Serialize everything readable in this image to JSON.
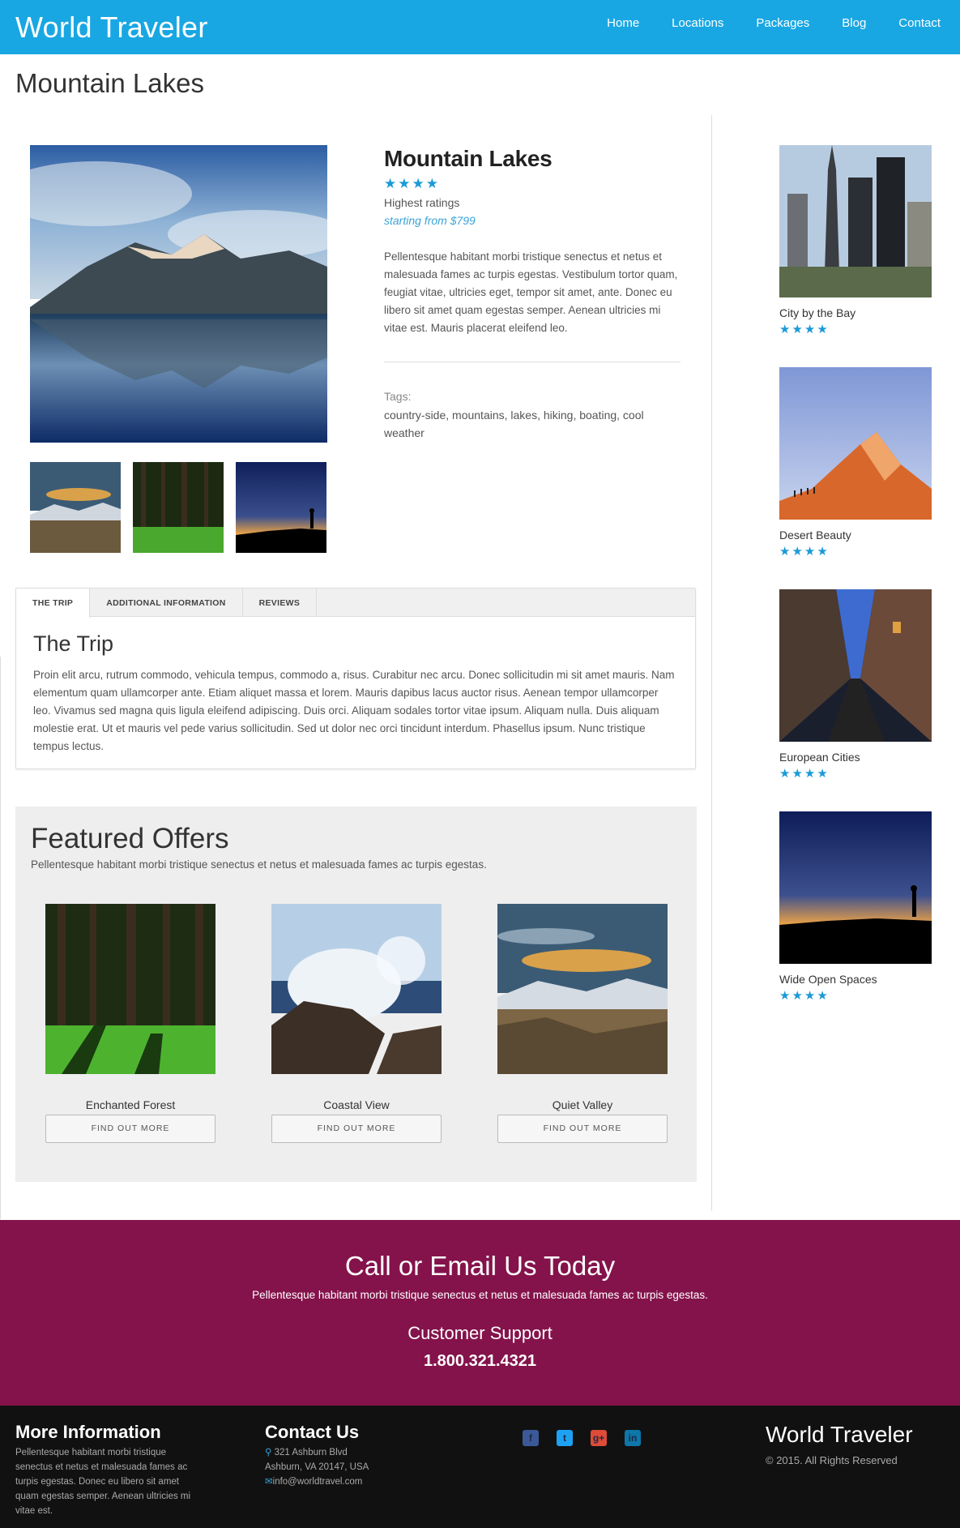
{
  "header": {
    "brand": "World Traveler",
    "nav": [
      "Home",
      "Locations",
      "Packages",
      "Blog",
      "Contact"
    ]
  },
  "page_title": "Mountain Lakes",
  "product": {
    "title": "Mountain Lakes",
    "stars": "★★★★",
    "rating_text": "Highest ratings",
    "price": "starting from $799",
    "description": "Pellentesque habitant morbi tristique senectus et netus et malesuada fames ac turpis egestas. Vestibulum tortor quam, feugiat vitae, ultricies eget, tempor sit amet, ante. Donec eu libero sit amet quam egestas semper. Aenean ultricies mi vitae est. Mauris placerat eleifend leo.",
    "tags_label": "Tags:",
    "tags": "country-side, mountains, lakes, hiking, boating, cool weather"
  },
  "tabs": {
    "items": [
      "THE TRIP",
      "ADDITIONAL INFORMATION",
      "REVIEWS"
    ],
    "active_title": "The Trip",
    "body": "Proin elit arcu, rutrum commodo, vehicula tempus, commodo a, risus. Curabitur nec arcu. Donec sollicitudin mi sit amet mauris. Nam elementum quam ullamcorper ante. Etiam aliquet massa et lorem. Mauris dapibus lacus auctor risus. Aenean tempor ullamcorper leo. Vivamus sed magna quis ligula eleifend adipiscing. Duis orci. Aliquam sodales tortor vitae ipsum. Aliquam nulla. Duis aliquam molestie erat. Ut et mauris vel pede varius sollicitudin. Sed ut dolor nec orci tincidunt interdum. Phasellus ipsum. Nunc tristique tempus lectus."
  },
  "featured": {
    "title": "Featured Offers",
    "subtitle": "Pellentesque habitant morbi tristique senectus et netus et malesuada fames ac turpis egestas.",
    "offers": [
      {
        "name": "Enchanted Forest",
        "button": "FIND OUT MORE"
      },
      {
        "name": "Coastal View",
        "button": "FIND OUT MORE"
      },
      {
        "name": "Quiet Valley",
        "button": "FIND OUT MORE"
      }
    ]
  },
  "sidebar": [
    {
      "name": "City by the Bay",
      "stars": "★★★★"
    },
    {
      "name": "Desert Beauty",
      "stars": "★★★★"
    },
    {
      "name": "European Cities",
      "stars": "★★★★"
    },
    {
      "name": "Wide Open Spaces",
      "stars": "★★★★"
    }
  ],
  "callout": {
    "title": "Call or Email Us Today",
    "subtitle": "Pellentesque habitant morbi tristique senectus et netus et malesuada fames ac turpis egestas.",
    "support_label": "Customer Support",
    "phone": "1.800.321.4321"
  },
  "footer": {
    "more_title": "More Information",
    "more_text": "Pellentesque habitant morbi tristique senectus et netus et malesuada fames ac turpis egestas. Donec eu libero sit amet quam egestas semper. Aenean ultricies mi vitae est.",
    "contact_title": "Contact Us",
    "address1": "321 Ashburn Blvd",
    "address2": "Ashburn, VA 20147, USA",
    "email": "info@worldtravel.com",
    "brand": "World Traveler",
    "copyright": "© 2015. All Rights Reserved",
    "social_icons": [
      "facebook-icon",
      "twitter-icon",
      "google-plus-icon",
      "linkedin-icon"
    ]
  },
  "colors": {
    "header": "#19a7e3",
    "accent_star": "#1a9ad6",
    "callout": "#84134b",
    "footer": "#111111"
  }
}
